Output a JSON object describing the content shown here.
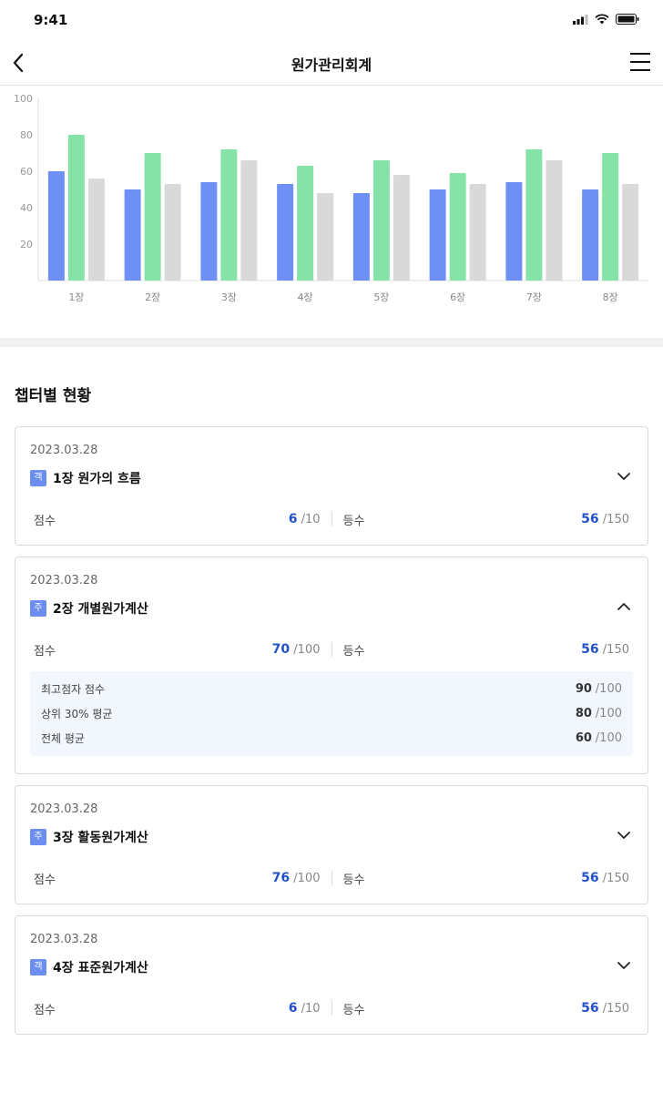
{
  "status_bar": {
    "time": "9:41"
  },
  "header": {
    "title": "원가관리회계"
  },
  "chart_data": {
    "type": "bar",
    "categories": [
      "1장",
      "2장",
      "3장",
      "4장",
      "5장",
      "6장",
      "7장",
      "8장"
    ],
    "series": [
      {
        "color": "#6e90f5",
        "values": [
          60,
          50,
          54,
          53,
          48,
          50,
          54,
          50
        ]
      },
      {
        "color": "#86e3a8",
        "values": [
          80,
          70,
          72,
          63,
          66,
          59,
          72,
          70
        ]
      },
      {
        "color": "#d9d9d9",
        "values": [
          56,
          53,
          66,
          48,
          58,
          53,
          66,
          53
        ]
      }
    ],
    "yticks": [
      20,
      40,
      60,
      80,
      100
    ],
    "ylim": [
      0,
      100
    ]
  },
  "section": {
    "title": "챕터별 현황"
  },
  "cards": [
    {
      "date": "2023.03.28",
      "tag": "객",
      "title": "1장 원가의 흐름",
      "expanded": false,
      "score_label": "점수",
      "score": "6",
      "score_total": "/10",
      "rank_label": "등수",
      "rank": "56",
      "rank_total": "/150"
    },
    {
      "date": "2023.03.28",
      "tag": "주",
      "title": "2장 개별원가계산",
      "expanded": true,
      "score_label": "점수",
      "score": "70",
      "score_total": "/100",
      "rank_label": "등수",
      "rank": "56",
      "rank_total": "/150",
      "stats": [
        {
          "label": "최고점자 점수",
          "value": "90",
          "total": "/100"
        },
        {
          "label": "상위 30% 평균",
          "value": "80",
          "total": "/100"
        },
        {
          "label": "전체 평균",
          "value": "60",
          "total": "/100"
        }
      ]
    },
    {
      "date": "2023.03.28",
      "tag": "주",
      "title": "3장 활동원가계산",
      "expanded": false,
      "score_label": "점수",
      "score": "76",
      "score_total": "/100",
      "rank_label": "등수",
      "rank": "56",
      "rank_total": "/150"
    },
    {
      "date": "2023.03.28",
      "tag": "객",
      "title": "4장 표준원가계산",
      "expanded": false,
      "score_label": "점수",
      "score": "6",
      "score_total": "/10",
      "rank_label": "등수",
      "rank": "56",
      "rank_total": "/150"
    }
  ]
}
